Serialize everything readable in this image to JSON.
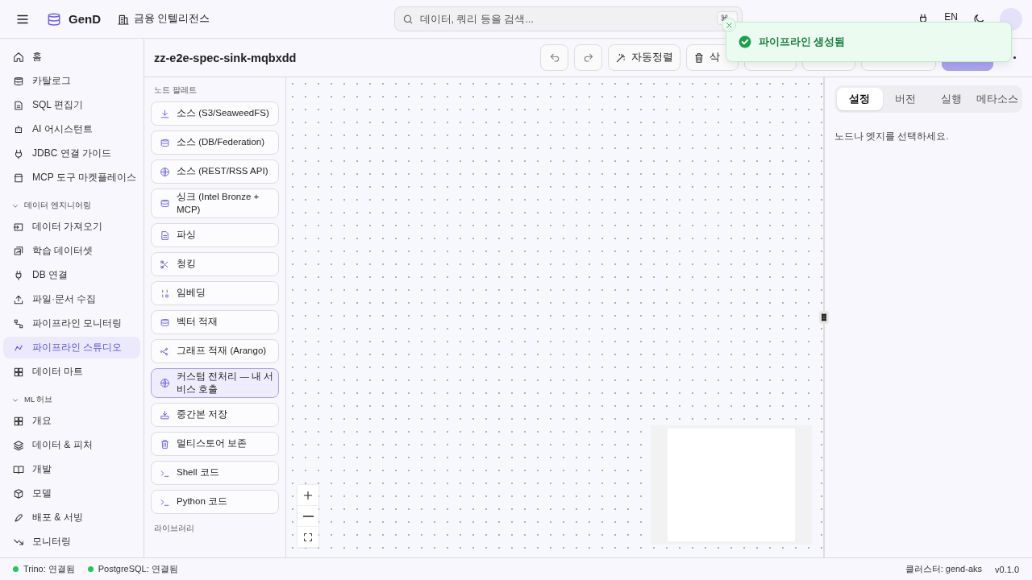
{
  "topbar": {
    "brand": "GenD",
    "workspace": "금융 인텔리전스",
    "search": {
      "placeholder": "데이터, 쿼리 등을 검색...",
      "shortcut": "⌘"
    },
    "language": "EN"
  },
  "toast": {
    "message": "파이프라인 생성됨"
  },
  "sidebar": {
    "items": [
      {
        "label": "홈",
        "selected": false
      },
      {
        "label": "카탈로그",
        "selected": false
      },
      {
        "label": "SQL 편집기",
        "selected": false
      },
      {
        "label": "AI 어시스턴트",
        "selected": false
      },
      {
        "label": "JDBC 연결 가이드",
        "selected": false
      },
      {
        "label": "MCP 도구 마켓플레이스",
        "selected": false
      }
    ],
    "sections": [
      {
        "title": "데이터 엔지니어링",
        "expanded": true,
        "items": [
          {
            "label": "데이터 가져오기",
            "selected": false
          },
          {
            "label": "학습 데이터셋",
            "selected": false
          },
          {
            "label": "DB 연결",
            "selected": false
          },
          {
            "label": "파일·문서 수집",
            "selected": false
          },
          {
            "label": "파이프라인 모니터링",
            "selected": false
          },
          {
            "label": "파이프라인 스튜디오",
            "selected": true
          },
          {
            "label": "데이터 마트",
            "selected": false
          }
        ]
      },
      {
        "title": "ML 허브",
        "expanded": true,
        "items": [
          {
            "label": "개요",
            "selected": false
          },
          {
            "label": "데이터 & 피처",
            "selected": false
          },
          {
            "label": "개발",
            "selected": false
          },
          {
            "label": "모델",
            "selected": false
          },
          {
            "label": "배포 & 서빙",
            "selected": false
          },
          {
            "label": "모니터링",
            "selected": false
          }
        ]
      }
    ]
  },
  "pipeline": {
    "title": "zz-e2e-spec-sink-mqbxdd",
    "toolbar": [
      {
        "kind": "undo"
      },
      {
        "kind": "redo"
      },
      {
        "kind": "text",
        "label": "자동정렬"
      },
      {
        "kind": "text",
        "label": "삭"
      },
      {
        "kind": "blank"
      },
      {
        "kind": "blank"
      },
      {
        "kind": "blank"
      },
      {
        "kind": "primary"
      }
    ]
  },
  "palette": {
    "title": "노드 팔레트",
    "items": [
      {
        "label": "소스 (S3/SeaweedFS)",
        "selected": false
      },
      {
        "label": "소스 (DB/Federation)",
        "selected": false
      },
      {
        "label": "소스 (REST/RSS API)",
        "selected": false
      },
      {
        "label": "싱크 (Intel Bronze + MCP)",
        "selected": false
      },
      {
        "label": "파싱",
        "selected": false
      },
      {
        "label": "청킹",
        "selected": false
      },
      {
        "label": "임베딩",
        "selected": false
      },
      {
        "label": "벡터 적재",
        "selected": false
      },
      {
        "label": "그래프 적재 (Arango)",
        "selected": false
      },
      {
        "label": "커스텀 전처리 — 내 서비스 호출",
        "selected": true
      },
      {
        "label": "중간본 저장",
        "selected": false
      },
      {
        "label": "멀티스토어 보존",
        "selected": false
      },
      {
        "label": "Shell 코드",
        "selected": false
      },
      {
        "label": "Python 코드",
        "selected": false
      }
    ],
    "library_title": "라이브러리"
  },
  "inspector": {
    "tabs": [
      {
        "label": "설정",
        "selected": true
      },
      {
        "label": "버전",
        "selected": false
      },
      {
        "label": "실행",
        "selected": false
      },
      {
        "label": "메타소스",
        "selected": false
      }
    ],
    "empty_message": "노드나 엣지를 선택하세요."
  },
  "status_bar": {
    "connections": [
      {
        "label": "Trino: 연결됨",
        "color": "#22c55e"
      },
      {
        "label": "PostgreSQL: 연결됨",
        "color": "#22c55e"
      }
    ],
    "cluster": "클러스터: gend-aks",
    "version": "v0.1.0"
  }
}
